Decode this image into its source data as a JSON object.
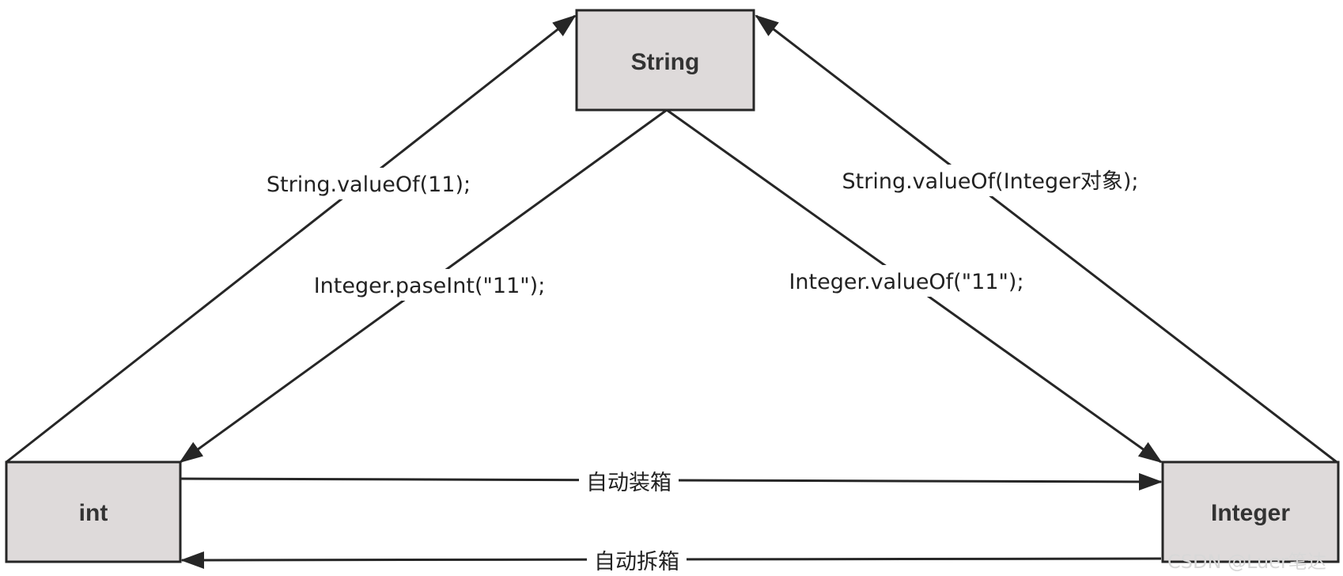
{
  "nodes": {
    "string": {
      "label": "String"
    },
    "int": {
      "label": "int"
    },
    "integer": {
      "label": "Integer"
    }
  },
  "edges": {
    "int_to_string": {
      "label": "String.valueOf(11);"
    },
    "string_to_int": {
      "label": "Integer.paseInt(\"11\");"
    },
    "string_to_integer": {
      "label": "Integer.valueOf(\"11\");"
    },
    "integer_to_string": {
      "label": "String.valueOf(Integer对象);"
    },
    "int_to_integer": {
      "label": "自动装箱"
    },
    "integer_to_int": {
      "label": "自动拆箱"
    }
  },
  "watermark": "CSDN @Luer笔达",
  "colors": {
    "node_fill": "#dedada",
    "stroke": "#262626"
  }
}
